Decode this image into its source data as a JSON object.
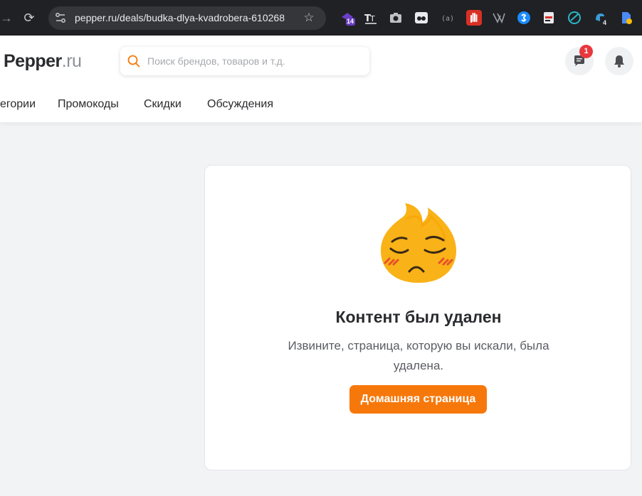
{
  "browser": {
    "url": "pepper.ru/deals/budka-dlya-kvadrobera-610268",
    "extension_badges": {
      "ext1": "14",
      "ext13": "4"
    }
  },
  "header": {
    "logo_main": "Pepper",
    "logo_tld": ".ru",
    "search_placeholder": "Поиск брендов, товаров и т.д.",
    "messages_badge": "1",
    "nav": [
      "егории",
      "Промокоды",
      "Скидки",
      "Обсуждения"
    ]
  },
  "content": {
    "title": "Контент был удален",
    "message": "Извините, страница, которую вы искали, была удалена.",
    "home_button": "Домашняя страница"
  },
  "colors": {
    "accent": "#f7780a",
    "badge": "#e8383d",
    "chrome_bg": "#202124"
  }
}
